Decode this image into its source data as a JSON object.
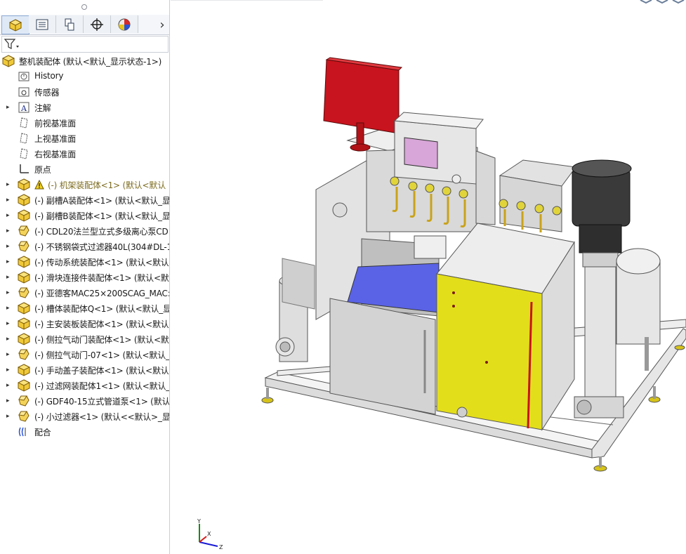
{
  "toolbar_tabs": [
    {
      "name": "feature-manager-icon",
      "label": ""
    },
    {
      "name": "property-manager-icon",
      "label": ""
    },
    {
      "name": "configuration-manager-icon",
      "label": ""
    },
    {
      "name": "dimxpert-manager-icon",
      "label": ""
    },
    {
      "name": "display-manager-icon",
      "label": ""
    }
  ],
  "tab_more_glyph": "›",
  "filter_icon": "filter-icon",
  "tree": {
    "root": "整机装配体 (默认<默认_显示状态-1>)",
    "items": [
      {
        "label": "History",
        "icon": "history-icon",
        "expandable": false
      },
      {
        "label": "传感器",
        "icon": "sensor-folder-icon",
        "expandable": false
      },
      {
        "label": "注解",
        "icon": "annotations-icon",
        "expandable": true
      },
      {
        "label": "前视基准面",
        "icon": "plane-icon",
        "expandable": false
      },
      {
        "label": "上视基准面",
        "icon": "plane-icon",
        "expandable": false
      },
      {
        "label": "右视基准面",
        "icon": "plane-icon",
        "expandable": false
      },
      {
        "label": "原点",
        "icon": "origin-icon",
        "expandable": false
      },
      {
        "label": "(-) 机架装配体<1> (默认<默认",
        "icon": "subassembly-icon",
        "expandable": true,
        "warning": true
      },
      {
        "label": "(-) 副槽A装配体<1> (默认<默认_显",
        "icon": "subassembly-icon",
        "expandable": true
      },
      {
        "label": "(-) 副槽B装配体<1> (默认<默认_显",
        "icon": "subassembly-icon",
        "expandable": true
      },
      {
        "label": "(-) CDL20法兰型立式多级离心泵CD",
        "icon": "part-icon",
        "expandable": true
      },
      {
        "label": "(-) 不锈钢袋式过滤器40L(304#DL-1",
        "icon": "part-icon",
        "expandable": true
      },
      {
        "label": "(-) 传动系统装配体<1> (默认<默认",
        "icon": "subassembly-icon",
        "expandable": true
      },
      {
        "label": "(-) 滑块连接件装配体<1> (默认<默",
        "icon": "subassembly-icon",
        "expandable": true
      },
      {
        "label": "(-) 亚德客MAC25×200SCAG_MAC:",
        "icon": "part-icon",
        "expandable": true
      },
      {
        "label": "(-) 槽体装配体Q<1> (默认<默认_显",
        "icon": "subassembly-icon",
        "expandable": true
      },
      {
        "label": "(-) 主安装板装配体<1> (默认<默认",
        "icon": "subassembly-icon",
        "expandable": true
      },
      {
        "label": "(-) 侧拉气动门装配体<1> (默认<默",
        "icon": "subassembly-icon",
        "expandable": true
      },
      {
        "label": "(-) 侧拉气动门-07<1> (默认<默认_",
        "icon": "part-icon",
        "expandable": true
      },
      {
        "label": "(-) 手动盖子装配体<1> (默认<默认",
        "icon": "subassembly-icon",
        "expandable": true
      },
      {
        "label": "(-) 过滤网装配体1<1> (默认<默认_",
        "icon": "subassembly-icon",
        "expandable": true
      },
      {
        "label": "(-) GDF40-15立式管道泵<1> (默认",
        "icon": "part-icon",
        "expandable": true
      },
      {
        "label": "(-) 小过滤器<1> (默认<<默认>_显:",
        "icon": "part-icon",
        "expandable": true
      },
      {
        "label": "配合",
        "icon": "mates-icon",
        "expandable": false
      }
    ]
  },
  "triad": {
    "x": "X",
    "y": "Y",
    "z": "Z"
  },
  "colors": {
    "panel_border": "#c9ced6",
    "accent_red": "#c8141e",
    "door_yellow": "#e3de1a",
    "mesh_blue": "#5a63e6",
    "frame_white": "#f2f2f2",
    "steel_gray": "#d3d3d3"
  }
}
